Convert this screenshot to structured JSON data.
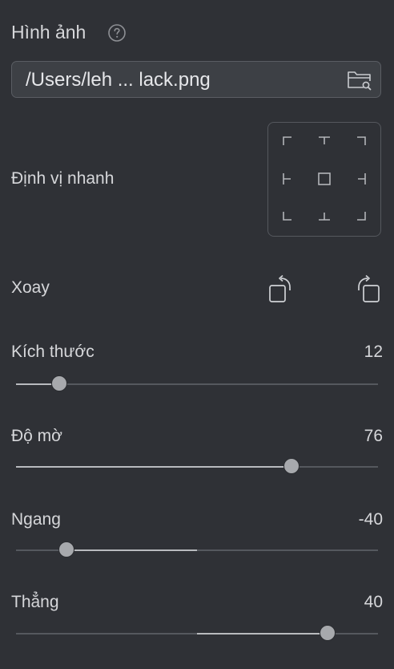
{
  "section": {
    "title": "Hình ảnh",
    "help_icon": "question-circle-icon"
  },
  "file": {
    "path": "/Users/leh ... lack.png",
    "browse_icon": "folder-search-icon"
  },
  "quick_position": {
    "label": "Định vị nhanh",
    "cells": [
      "top-left",
      "top-center",
      "top-right",
      "middle-left",
      "center",
      "middle-right",
      "bottom-left",
      "bottom-center",
      "bottom-right"
    ]
  },
  "rotate": {
    "label": "Xoay",
    "left_icon": "rotate-left-icon",
    "right_icon": "rotate-right-icon"
  },
  "sliders": [
    {
      "key": "size",
      "label": "Kích thước",
      "value": "12",
      "position": 0.12,
      "fill_from": 0.0
    },
    {
      "key": "opacity",
      "label": "Độ mờ",
      "value": "76",
      "position": 0.76,
      "fill_from": 0.0
    },
    {
      "key": "horizontal",
      "label": "Ngang",
      "value": "-40",
      "position": 0.14,
      "fill_from": 0.5
    },
    {
      "key": "vertical",
      "label": "Thẳng",
      "value": "40",
      "position": 0.86,
      "fill_from": 0.5
    }
  ]
}
